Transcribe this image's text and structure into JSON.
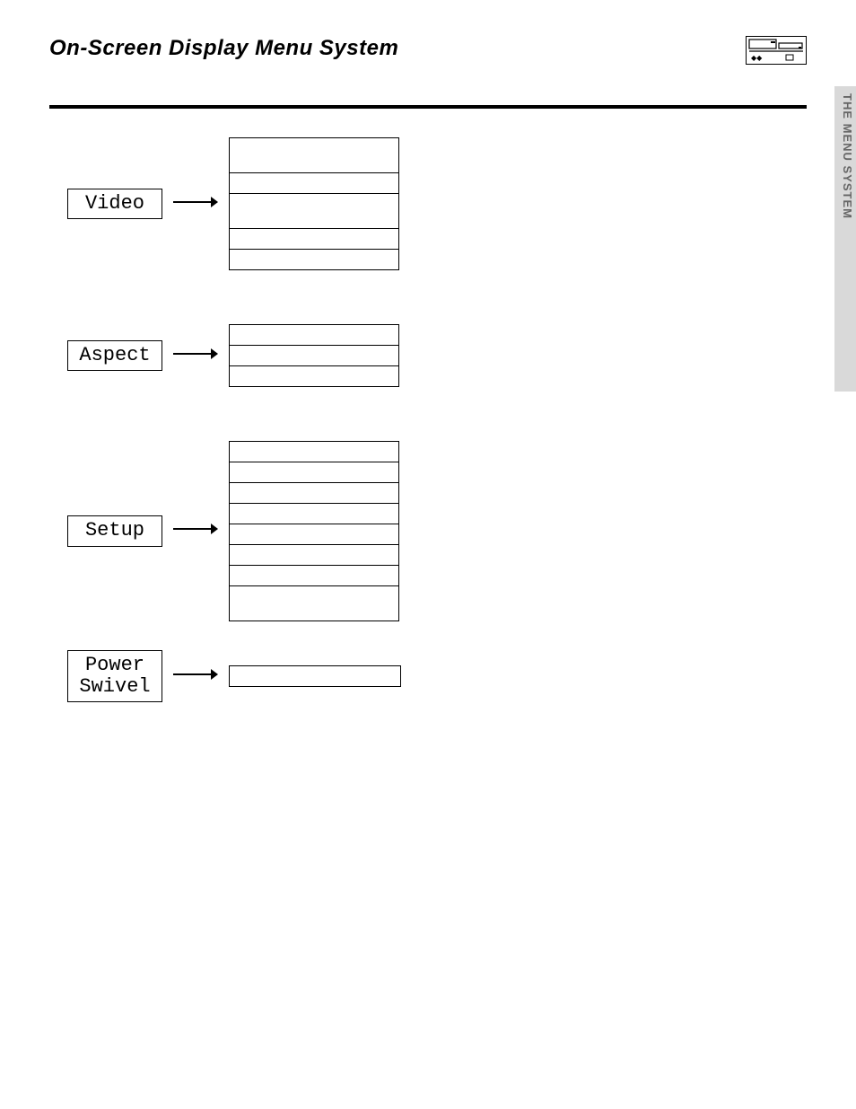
{
  "header": {
    "title": "On-Screen Display Menu System"
  },
  "sections": [
    {
      "menu_label": "Video",
      "rows": [
        {
          "h": "tall"
        },
        {
          "h": "short"
        },
        {
          "h": "tall"
        },
        {
          "h": "short"
        },
        {
          "h": "short"
        }
      ]
    },
    {
      "menu_label": "Aspect",
      "rows": [
        {
          "h": "short"
        },
        {
          "h": "short"
        },
        {
          "h": "short"
        }
      ]
    },
    {
      "menu_label": "Setup",
      "rows": [
        {
          "h": "short"
        },
        {
          "h": "short"
        },
        {
          "h": "short"
        },
        {
          "h": "short"
        },
        {
          "h": "short"
        },
        {
          "h": "short"
        },
        {
          "h": "short"
        },
        {
          "h": "tall"
        }
      ]
    }
  ],
  "power_swivel": {
    "menu_label": "Power\nSwivel"
  },
  "sidebar": {
    "label": "THE MENU SYSTEM"
  }
}
